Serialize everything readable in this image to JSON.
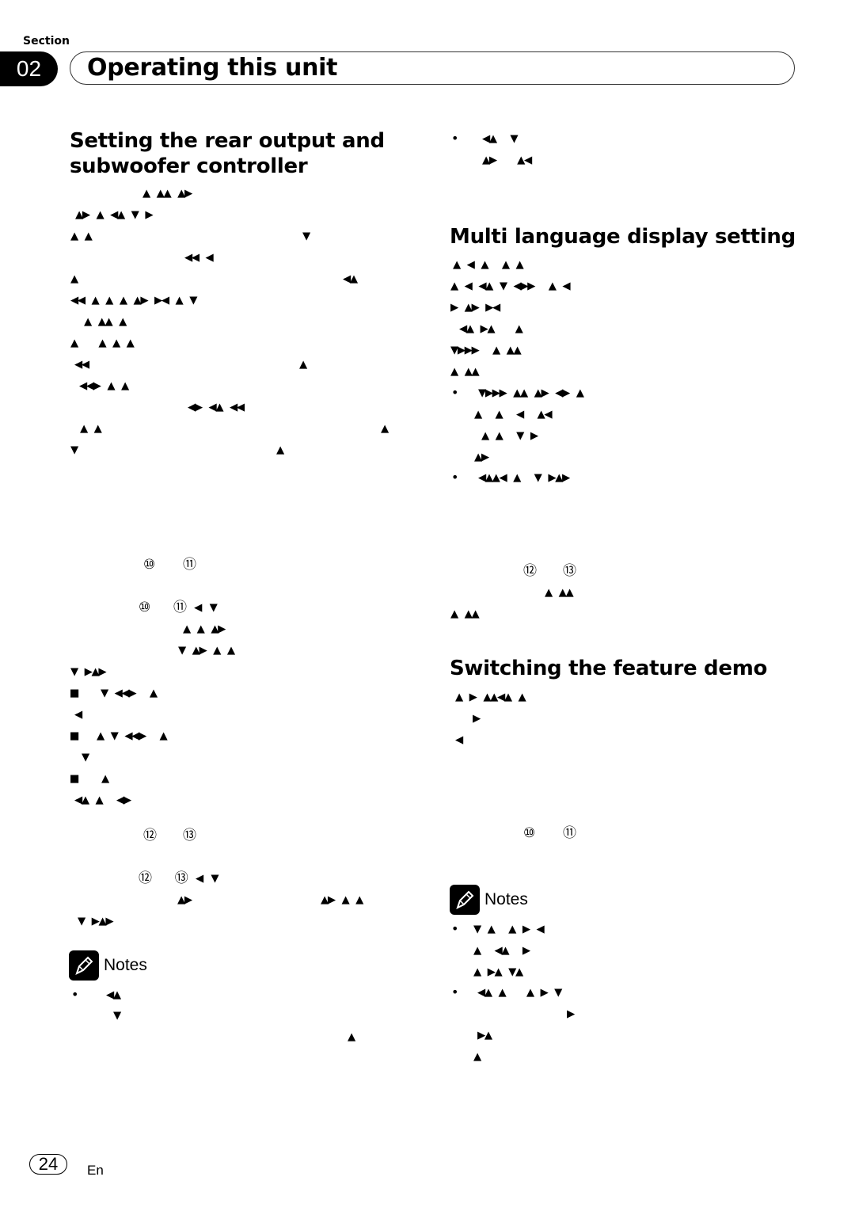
{
  "header": {
    "section_label": "Section",
    "section_number": "02",
    "chapter_title": "Operating this unit"
  },
  "left": {
    "heading": "Setting the rear output and subwoofer controller",
    "heading_line1": "Setting the rear output and",
    "heading_line2": "subwoofer controller",
    "lines": [
      "▲ ▲▲ ▲▶",
      "▲▶ ▲ ◀▲ ▼ ▶",
      "▲ ▲",
      "▼",
      "◀◀ ◀",
      "▲",
      "◀▲",
      "◀◀ ▲ ▲ ▲ ▲▶ ▶◀ ▲ ▼",
      "▲ ▲▲ ▲",
      "▲   ▲ ▲ ▲",
      "◀◀",
      "▲",
      "◀◀▶ ▲ ▲",
      "◀▶ ◀▲ ◀◀",
      "▲ ▲",
      "▲",
      "▼",
      "▲"
    ],
    "step_a_refs": [
      "⑩",
      "⑪"
    ],
    "step_a_line": "⑩   ⑪ ◀ ▼",
    "step_a_more": [
      "▲ ▲ ▲▶",
      "▼ ▲▶ ▲ ▲",
      "▼ ▶▲▶"
    ],
    "options": [
      {
        "marker": "■",
        "text": "▼ ◀◀▶  ▲",
        "sub": "◀"
      },
      {
        "marker": "■",
        "text": "▲ ▼ ◀◀▶  ▲",
        "sub": "▼"
      },
      {
        "marker": "■",
        "text": "▲",
        "sub": "◀▲ ▲  ◀▶"
      }
    ],
    "step_b_refs": [
      "⑫",
      "⑬"
    ],
    "step_b_line": "⑫   ⑬ ◀ ▼",
    "step_b_more": [
      "▲▶",
      "▲▶ ▲ ▲",
      "▼ ▶▲▶"
    ],
    "notes_label": "Notes",
    "notes": [
      {
        "bullet": "•",
        "lines": [
          "◀▲",
          "▼",
          "▲"
        ]
      }
    ]
  },
  "right": {
    "top_note": {
      "bullet": "•",
      "lines": [
        "◀▲  ▼",
        "▲▶   ▲◀"
      ]
    },
    "heading_multilang": "Multi language display setting",
    "multilang_lines": [
      "▲ ◀ ▲  ▲ ▲",
      "▲ ◀ ◀▲ ▼ ◀▶▶  ▲ ◀",
      "▶ ▲▶ ▶◀",
      "◀▲ ▶▲   ▲",
      "▼▶▶▶  ▲ ▲▲",
      "▲ ▲▲"
    ],
    "multilang_bullets": [
      {
        "bullet": "•",
        "lines": [
          "▼▶▶▶ ▲▲ ▲▶ ◀▶ ▲",
          "▲  ▲  ◀  ▲◀",
          "▲ ▲  ▼ ▶",
          "▲▶"
        ]
      },
      {
        "bullet": "•",
        "lines": [
          "◀▲▲◀ ▲  ▼ ▶▲▶"
        ]
      }
    ],
    "multilang_step_refs": [
      "⑫",
      "⑬"
    ],
    "multilang_step_more": [
      "▲ ▲▲",
      "▲ ▲▲"
    ],
    "heading_demo": "Switching the feature demo",
    "demo_lines": [
      "▲ ▶ ▲▲◀▲ ▲",
      "▶",
      "◀"
    ],
    "demo_step_refs": [
      "⑩",
      "⑪"
    ],
    "notes_label": "Notes",
    "notes": [
      {
        "bullet": "•",
        "lines": [
          "▼ ▲  ▲ ▶ ◀",
          "▲  ◀▲  ▶",
          "▲ ▶▲ ▼▲"
        ]
      },
      {
        "bullet": "•",
        "lines": [
          "◀▲ ▲   ▲ ▶ ▼",
          "▶",
          "▶▲",
          "▲"
        ]
      }
    ]
  },
  "footer": {
    "page_number": "24",
    "language": "En"
  }
}
